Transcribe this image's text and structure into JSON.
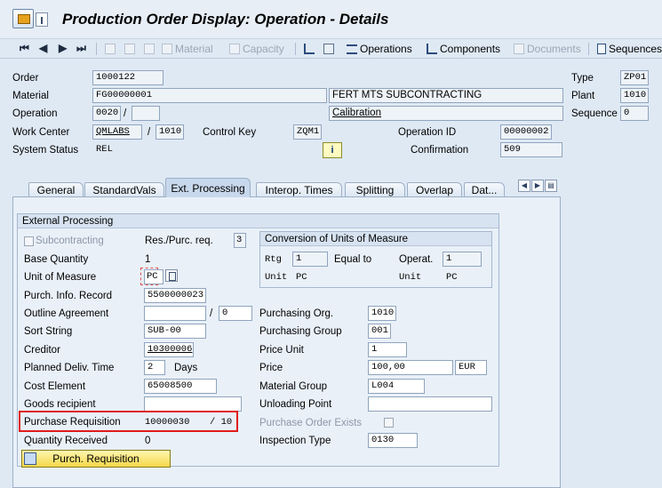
{
  "window": {
    "title": "Production Order Display: Operation - Details"
  },
  "toolbar": {
    "nav": [
      "⏮",
      "◀",
      "▶",
      "⏭"
    ],
    "material": "Material",
    "capacity": "Capacity",
    "operations": "Operations",
    "components": "Components",
    "documents": "Documents",
    "sequences": "Sequences"
  },
  "header": {
    "order_label": "Order",
    "order_value": "1000122",
    "material_label": "Material",
    "material_value": "FG00000001",
    "material_desc": "FERT MTS SUBCONTRACTING",
    "operation_label": "Operation",
    "operation_value": "0020",
    "operation_sep": "/",
    "operation_sub": "",
    "operation_desc": "Calibration",
    "workcenter_label": "Work Center",
    "workcenter_value": "QMLABS",
    "workcenter_sep": "/",
    "workcenter_plant": "1010",
    "controlkey_label": "Control Key",
    "controlkey_value": "ZQM1",
    "operationid_label": "Operation ID",
    "operationid_value": "00000002",
    "systemstatus_label": "System Status",
    "systemstatus_value": "REL",
    "info_btn": "i",
    "confirmation_label": "Confirmation",
    "confirmation_value": "509",
    "type_label": "Type",
    "type_value": "ZP01",
    "plant_label": "Plant",
    "plant_value": "1010",
    "sequence_label": "Sequence",
    "sequence_value": "0"
  },
  "tabs": [
    {
      "label": "General"
    },
    {
      "label": "StandardVals"
    },
    {
      "label": "Ext. Processing"
    },
    {
      "label": "Interop. Times"
    },
    {
      "label": "Splitting"
    },
    {
      "label": "Overlap"
    },
    {
      "label": "Dat..."
    }
  ],
  "ext": {
    "group_title": "External Processing",
    "subcontracting_label": "Subcontracting",
    "respurc_label": "Res./Purc. req.",
    "respurc_value": "3",
    "base_qty_label": "Base Quantity",
    "base_qty_value": "1",
    "uom_label": "Unit of Measure",
    "uom_value": "PC",
    "info_record_label": "Purch. Info. Record",
    "info_record_value": "5500000023",
    "outline_label": "Outline Agreement",
    "outline_value": "",
    "outline_sep": "/",
    "outline_item": "0",
    "sort_label": "Sort String",
    "sort_value": "SUB-00",
    "creditor_label": "Creditor",
    "creditor_value": "10300006",
    "deliv_label": "Planned Deliv. Time",
    "deliv_value": "2",
    "deliv_unit": "Days",
    "cost_label": "Cost Element",
    "cost_value": "65008500",
    "goods_label": "Goods recipient",
    "goods_value": "",
    "preq_label": "Purchase Requisition",
    "preq_value": "10000030",
    "preq_item": "/ 10",
    "qty_recv_label": "Quantity Received",
    "qty_recv_value": "0",
    "purch_req_btn": "Purch. Requisition",
    "conv_title": "Conversion of Units of Measure",
    "conv_rtg": "Rtg",
    "conv_rtg_value": "1",
    "conv_equal": "Equal to",
    "conv_operat": "Operat.",
    "conv_operat_value": "1",
    "conv_unit1": "Unit",
    "conv_unit1_value": "PC",
    "conv_unit2": "Unit",
    "conv_unit2_value": "PC",
    "porg_label": "Purchasing Org.",
    "porg_value": "1010",
    "pgrp_label": "Purchasing Group",
    "pgrp_value": "001",
    "punit_label": "Price Unit",
    "punit_value": "1",
    "price_label": "Price",
    "price_value": "100,00",
    "price_curr": "EUR",
    "matgrp_label": "Material Group",
    "matgrp_value": "L004",
    "unload_label": "Unloading Point",
    "unload_value": "",
    "po_exists_label": "Purchase Order Exists",
    "insp_label": "Inspection Type",
    "insp_value": "0130"
  }
}
